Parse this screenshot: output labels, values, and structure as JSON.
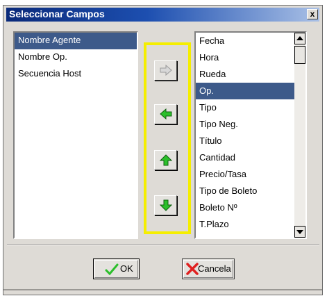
{
  "dialog": {
    "title": "Seleccionar Campos",
    "close_label": "x"
  },
  "left_list": {
    "items": [
      {
        "label": "Nombre Agente",
        "selected": true
      },
      {
        "label": "Nombre Op.",
        "selected": false
      },
      {
        "label": "Secuencia Host",
        "selected": false
      }
    ]
  },
  "right_list": {
    "items": [
      {
        "label": "Fecha",
        "selected": false
      },
      {
        "label": "Hora",
        "selected": false
      },
      {
        "label": "Rueda",
        "selected": false
      },
      {
        "label": "Op.",
        "selected": true
      },
      {
        "label": "Tipo",
        "selected": false
      },
      {
        "label": "Tipo Neg.",
        "selected": false
      },
      {
        "label": "Título",
        "selected": false
      },
      {
        "label": "Cantidad",
        "selected": false
      },
      {
        "label": "Precio/Tasa",
        "selected": false
      },
      {
        "label": "Tipo de Boleto",
        "selected": false
      },
      {
        "label": "Boleto Nº",
        "selected": false
      },
      {
        "label": "T.Plazo",
        "selected": false
      }
    ]
  },
  "buttons": {
    "ok_label": "OK",
    "cancel_label": "Cancela"
  },
  "colors": {
    "selection": "#3d5a8a",
    "highlight": "#f5ee00",
    "arrow_green": "#2bbf2b"
  }
}
